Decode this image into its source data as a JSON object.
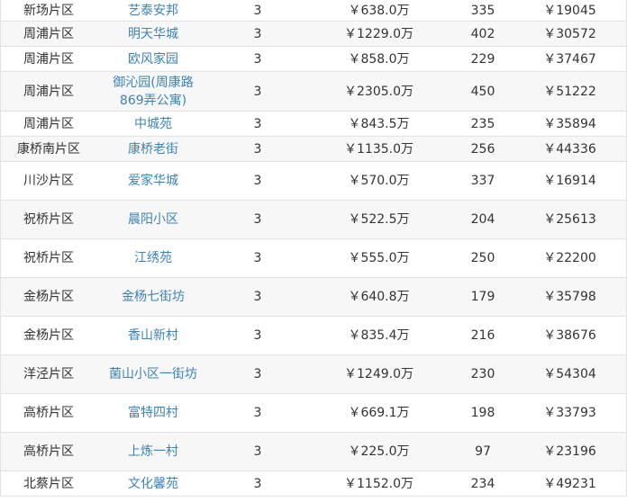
{
  "rows": [
    {
      "district": "新场片区",
      "community": "艺泰安邦",
      "rooms": "3",
      "price": "￥638.0万",
      "count": "335",
      "unit_price": "￥19045"
    },
    {
      "district": "周浦片区",
      "community": "明天华城",
      "rooms": "3",
      "price": "￥1229.0万",
      "count": "402",
      "unit_price": "￥30572"
    },
    {
      "district": "周浦片区",
      "community": "欧风家园",
      "rooms": "3",
      "price": "￥858.0万",
      "count": "229",
      "unit_price": "￥37467"
    },
    {
      "district": "周浦片区",
      "community": "御沁园(周康路869弄公寓)",
      "rooms": "3",
      "price": "￥2305.0万",
      "count": "450",
      "unit_price": "￥51222"
    },
    {
      "district": "周浦片区",
      "community": "中城苑",
      "rooms": "3",
      "price": "￥843.5万",
      "count": "235",
      "unit_price": "￥35894"
    },
    {
      "district": "康桥南片区",
      "community": "康桥老街",
      "rooms": "3",
      "price": "￥1135.0万",
      "count": "256",
      "unit_price": "￥44336"
    },
    {
      "district": "川沙片区",
      "community": "爱家华城",
      "rooms": "3",
      "price": "￥570.0万",
      "count": "337",
      "unit_price": "￥16914"
    },
    {
      "district": "祝桥片区",
      "community": "晨阳小区",
      "rooms": "3",
      "price": "￥522.5万",
      "count": "204",
      "unit_price": "￥25613"
    },
    {
      "district": "祝桥片区",
      "community": "江绣苑",
      "rooms": "3",
      "price": "￥555.0万",
      "count": "250",
      "unit_price": "￥22200"
    },
    {
      "district": "金杨片区",
      "community": "金杨七街坊",
      "rooms": "3",
      "price": "￥640.8万",
      "count": "179",
      "unit_price": "￥35798"
    },
    {
      "district": "金杨片区",
      "community": "香山新村",
      "rooms": "3",
      "price": "￥835.4万",
      "count": "216",
      "unit_price": "￥38676"
    },
    {
      "district": "洋泾片区",
      "community": "菌山小区一街坊",
      "rooms": "3",
      "price": "￥1249.0万",
      "count": "230",
      "unit_price": "￥54304"
    },
    {
      "district": "高桥片区",
      "community": "富特四村",
      "rooms": "3",
      "price": "￥669.1万",
      "count": "198",
      "unit_price": "￥33793"
    },
    {
      "district": "高桥片区",
      "community": "上炼一村",
      "rooms": "3",
      "price": "￥225.0万",
      "count": "97",
      "unit_price": "￥23196"
    },
    {
      "district": "北蔡片区",
      "community": "文化馨苑",
      "rooms": "3",
      "price": "￥1152.0万",
      "count": "234",
      "unit_price": "￥49231"
    }
  ]
}
